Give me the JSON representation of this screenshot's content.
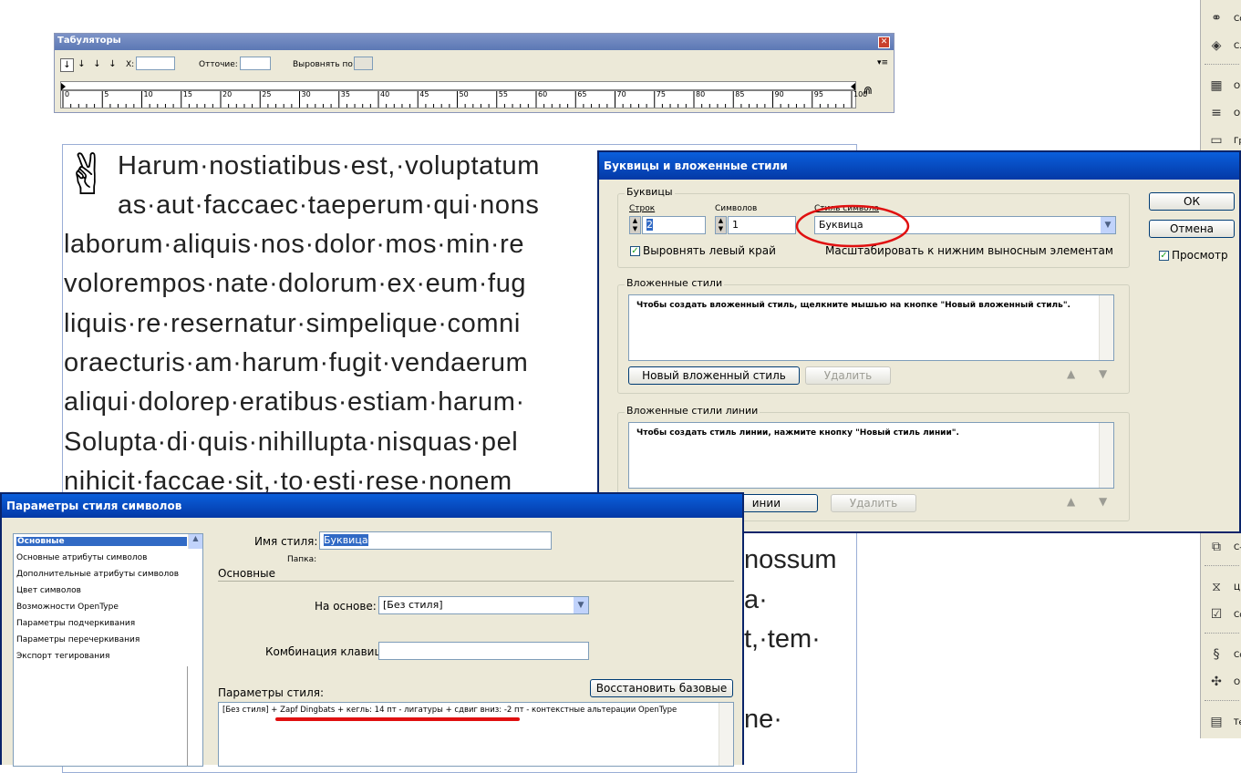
{
  "tabs_palette": {
    "title": "Табуляторы",
    "close_glyph": "✕",
    "x_label": "X:",
    "leader_label": "Отточие:",
    "align_label": "Выровнять по:",
    "menu_glyph": "▾≡",
    "ruler_ticks": [
      "0",
      "5",
      "10",
      "15",
      "20",
      "25",
      "30",
      "35",
      "40",
      "45",
      "50",
      "55",
      "60",
      "65",
      "70",
      "75",
      "80",
      "85",
      "90",
      "95",
      "100"
    ]
  },
  "text_frame": {
    "dropcap_glyph": "✌",
    "lines": [
      "Harum·nostiatibus·est,·voluptatum",
      "as·aut·faccaec·taeperum·qui·nons",
      "laborum·aliquis·nos·dolor·mos·min·re",
      "volorempos·nate·dolorum·ex·eum·fug",
      "liquis·re·resernatur·simpelique·comni",
      "oraecturis·am·harum·fugit·vendaerum",
      "aliqui·dolorep·eratibus·estiam·harum·",
      "Solupta·di·quis·nihillupta·nisquas·pel",
      "nihicit·faccae·sit,·to·esti·rese·nonem"
    ],
    "right_fragments": [
      "nossum",
      "a·",
      "t,·tem·",
      "ne·"
    ]
  },
  "right_toolbar": {
    "items": [
      {
        "icon": "link-icon",
        "label": "Co"
      },
      {
        "icon": "layers-icon",
        "label": "С..."
      },
      {
        "icon": "table-icon",
        "label": "О"
      },
      {
        "icon": "lines-icon",
        "label": "О"
      },
      {
        "icon": "gradient-icon",
        "label": "Гр"
      },
      {
        "icon": "transform-icon",
        "label": "С-"
      },
      {
        "icon": "hourglass-icon",
        "label": "Ц"
      },
      {
        "icon": "checkbox-icon",
        "label": "Со"
      },
      {
        "icon": "script-icon",
        "label": "Сс"
      },
      {
        "icon": "plugin-icon",
        "label": "О"
      },
      {
        "icon": "grid-icon",
        "label": "Те"
      }
    ]
  },
  "dropcaps_dialog": {
    "title": "Буквицы и вложенные стили",
    "group_dropcaps": "Буквицы",
    "lines_label": "Строк",
    "lines_value": "2",
    "chars_label": "Символов",
    "chars_value": "1",
    "char_style_label": "Стиль символа",
    "char_style_value": "Буквица",
    "align_left_label": "Выровнять левый край",
    "scale_label": "Масштабировать к нижним выносным элементам",
    "group_nested": "Вложенные стили",
    "nested_hint": "Чтобы создать вложенный стиль, щелкните мышью на кнопке \"Новый вложенный стиль\".",
    "new_nested_btn": "Новый вложенный стиль",
    "delete_btn": "Удалить",
    "group_line": "Вложенные стили линии",
    "line_hint": "Чтобы создать стиль линии, нажмите кнопку \"Новый стиль линии\".",
    "new_line_btn_fragment": "инии",
    "ok_btn": "ОК",
    "cancel_btn": "Отмена",
    "preview_label": "Просмотр"
  },
  "char_style_dialog": {
    "title": "Параметры стиля символов",
    "sidebar": [
      "Основные",
      "Основные атрибуты символов",
      "Дополнительные атрибуты символов",
      "Цвет символов",
      "Возможности OpenType",
      "Параметры подчеркивания",
      "Параметры перечеркивания",
      "Экспорт тегирования"
    ],
    "style_name_label": "Имя стиля:",
    "style_name_value": "Буквица",
    "folder_label": "Папка:",
    "section_label": "Основные",
    "based_on_label": "На основе:",
    "based_on_value": "[Без стиля]",
    "shortcut_label": "Комбинация клавиш:",
    "style_params_label": "Параметры стиля:",
    "reset_btn": "Восстановить базовые",
    "style_summary": "[Без стиля] + Zapf Dingbats + кегль: 14 пт - лигатуры + сдвиг вниз: -2 пт - контекстные альтерации OpenType"
  },
  "colors": {
    "title_bar": "#0a5fdc",
    "dialog_bg": "#ece9d8",
    "highlight": "#316ac5",
    "annotation_red": "#e01010"
  }
}
